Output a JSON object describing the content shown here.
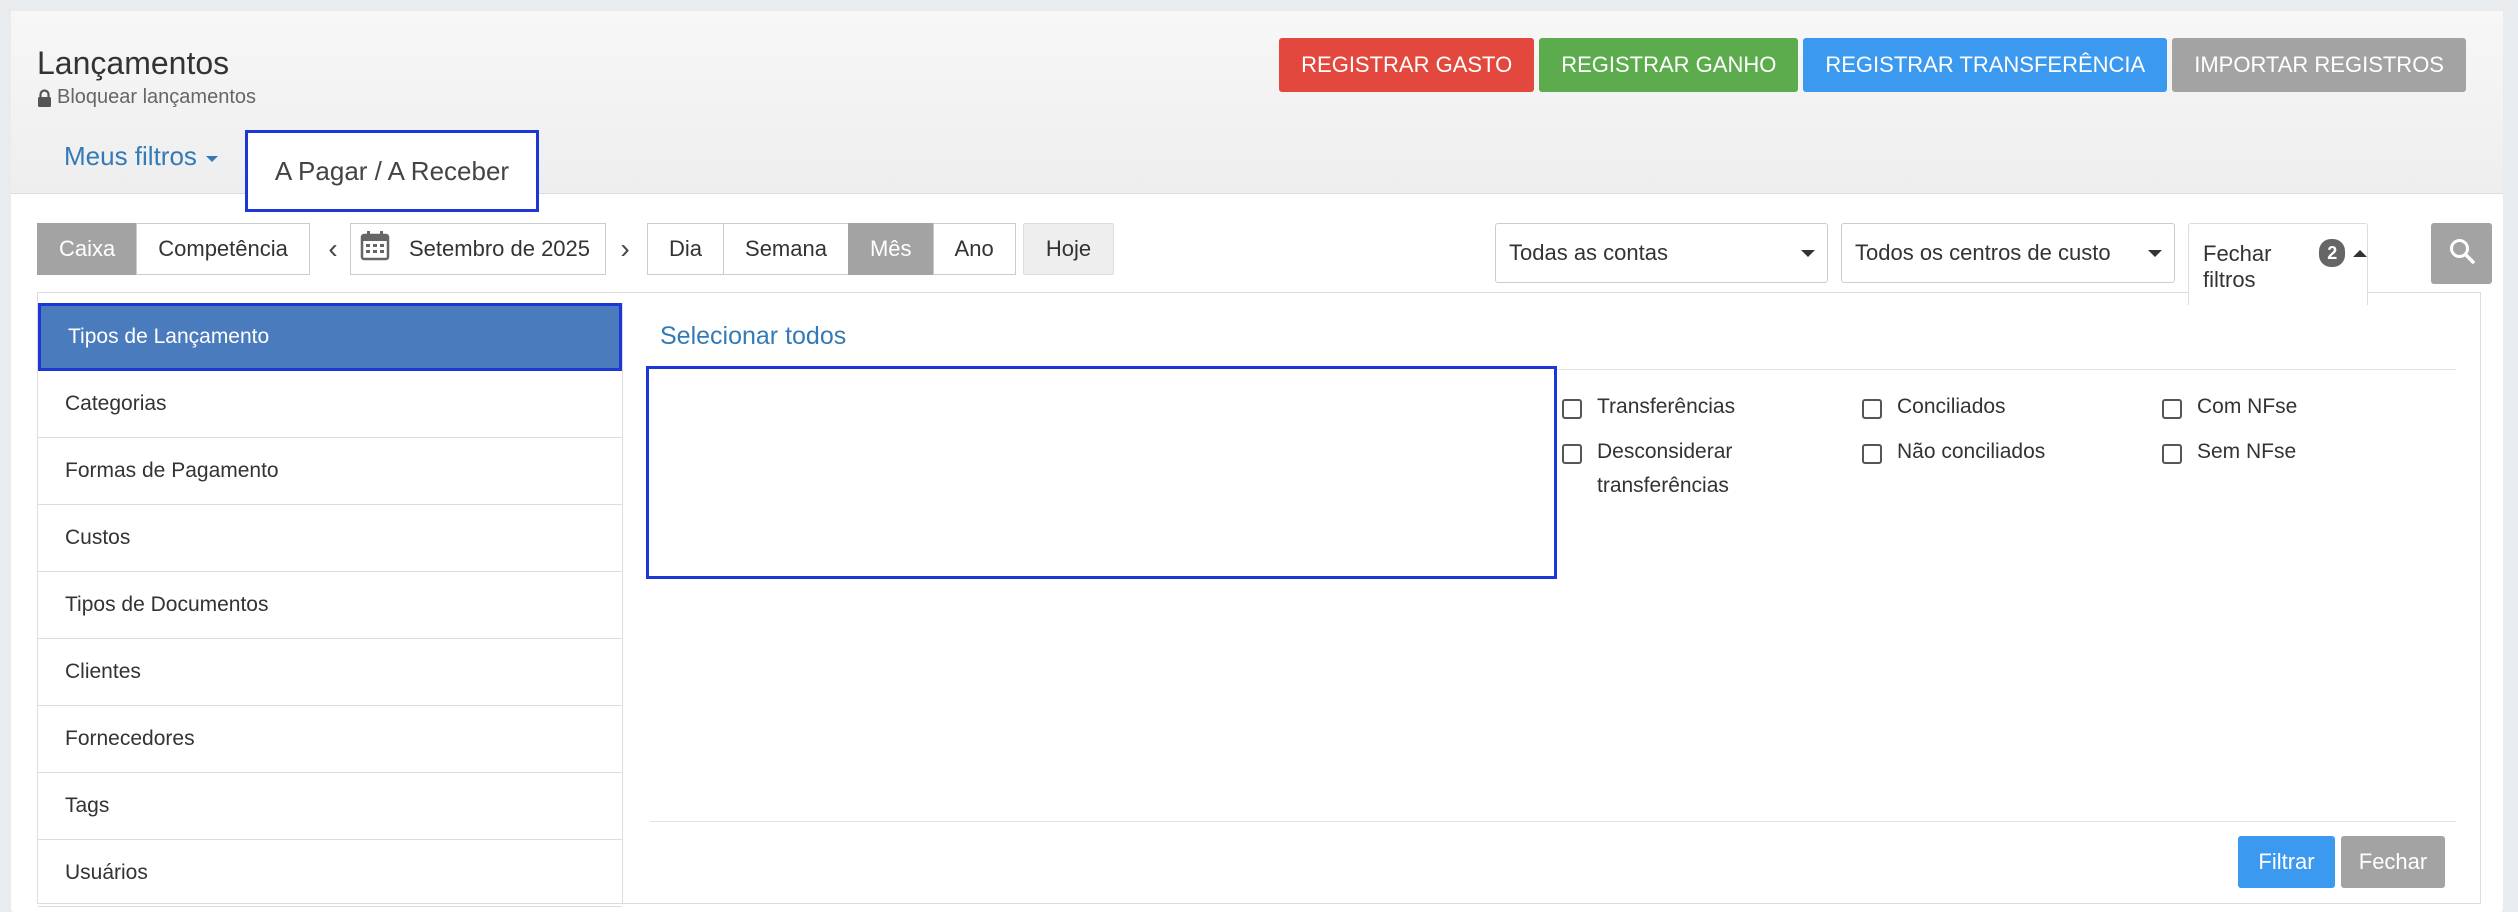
{
  "header": {
    "title": "Lançamentos",
    "lock_label": "Bloquear lançamentos",
    "actions": [
      {
        "label": "REGISTRAR GASTO",
        "color": "#e2483d"
      },
      {
        "label": "REGISTRAR GANHO",
        "color": "#5cac4e"
      },
      {
        "label": "REGISTRAR TRANSFERÊNCIA",
        "color": "#3b99f0"
      },
      {
        "label": "IMPORTAR REGISTROS",
        "color": "#a3a3a3"
      }
    ],
    "tabs": [
      {
        "label": "Meus filtros"
      },
      {
        "label": "A Pagar / A Receber"
      }
    ]
  },
  "toolbar": {
    "mode": [
      "Caixa",
      "Competência"
    ],
    "mode_selected": "Caixa",
    "prev_icon": "‹",
    "next_icon": "›",
    "period_label": "Setembro de 2025",
    "granularity": [
      "Dia",
      "Semana",
      "Mês",
      "Ano"
    ],
    "granularity_selected": "Mês",
    "today_label": "Hoje",
    "accounts_select": "Todas as contas",
    "cost_centers_select": "Todos os centros de custo",
    "close_filters_label": "Fechar filtros",
    "close_filters_count": "2"
  },
  "filters": {
    "categories": [
      "Tipos de Lançamento",
      "Categorias",
      "Formas de Pagamento",
      "Custos",
      "Tipos de Documentos",
      "Clientes",
      "Fornecedores",
      "Tags",
      "Usuários"
    ],
    "active_category": "Tipos de Lançamento",
    "select_all_label": "Selecionar todos",
    "options_col1": [
      "Transferências",
      "Desconsiderar transferências"
    ],
    "options_col2": [
      "Conciliados",
      "Não conciliados"
    ],
    "options_col3": [
      "Com NFse",
      "Sem NFse"
    ],
    "filter_button": "Filtrar",
    "close_button": "Fechar"
  },
  "colors": {
    "accent_blue": "#337ab7",
    "active_item": "#4a7bbd",
    "primary_button": "#3b99f0",
    "neutral_button": "#a3a3a3",
    "highlight_outline": "#1d36d6"
  }
}
